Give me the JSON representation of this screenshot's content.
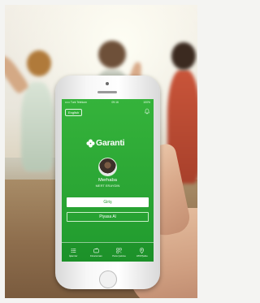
{
  "status_bar": {
    "carrier": "••••• Turk Telekom",
    "time": "09:16",
    "battery": "100%"
  },
  "language_button": "English",
  "logo_text": "Garanti",
  "greeting": "Merhaba",
  "user_name": "MERT ERAYDIN",
  "login_button": "Giriş",
  "market_button": "Piyasa Al",
  "tabs": [
    {
      "label": "İşlemler",
      "icon": "list-icon"
    },
    {
      "label": "Finansman",
      "icon": "wallet-icon"
    },
    {
      "label": "Para Çekme",
      "icon": "qr-icon"
    },
    {
      "label": "ATM/Şube",
      "icon": "location-pin-icon"
    }
  ],
  "colors": {
    "brand_green": "#2aa534",
    "button_text_green": "#2c9b38"
  }
}
